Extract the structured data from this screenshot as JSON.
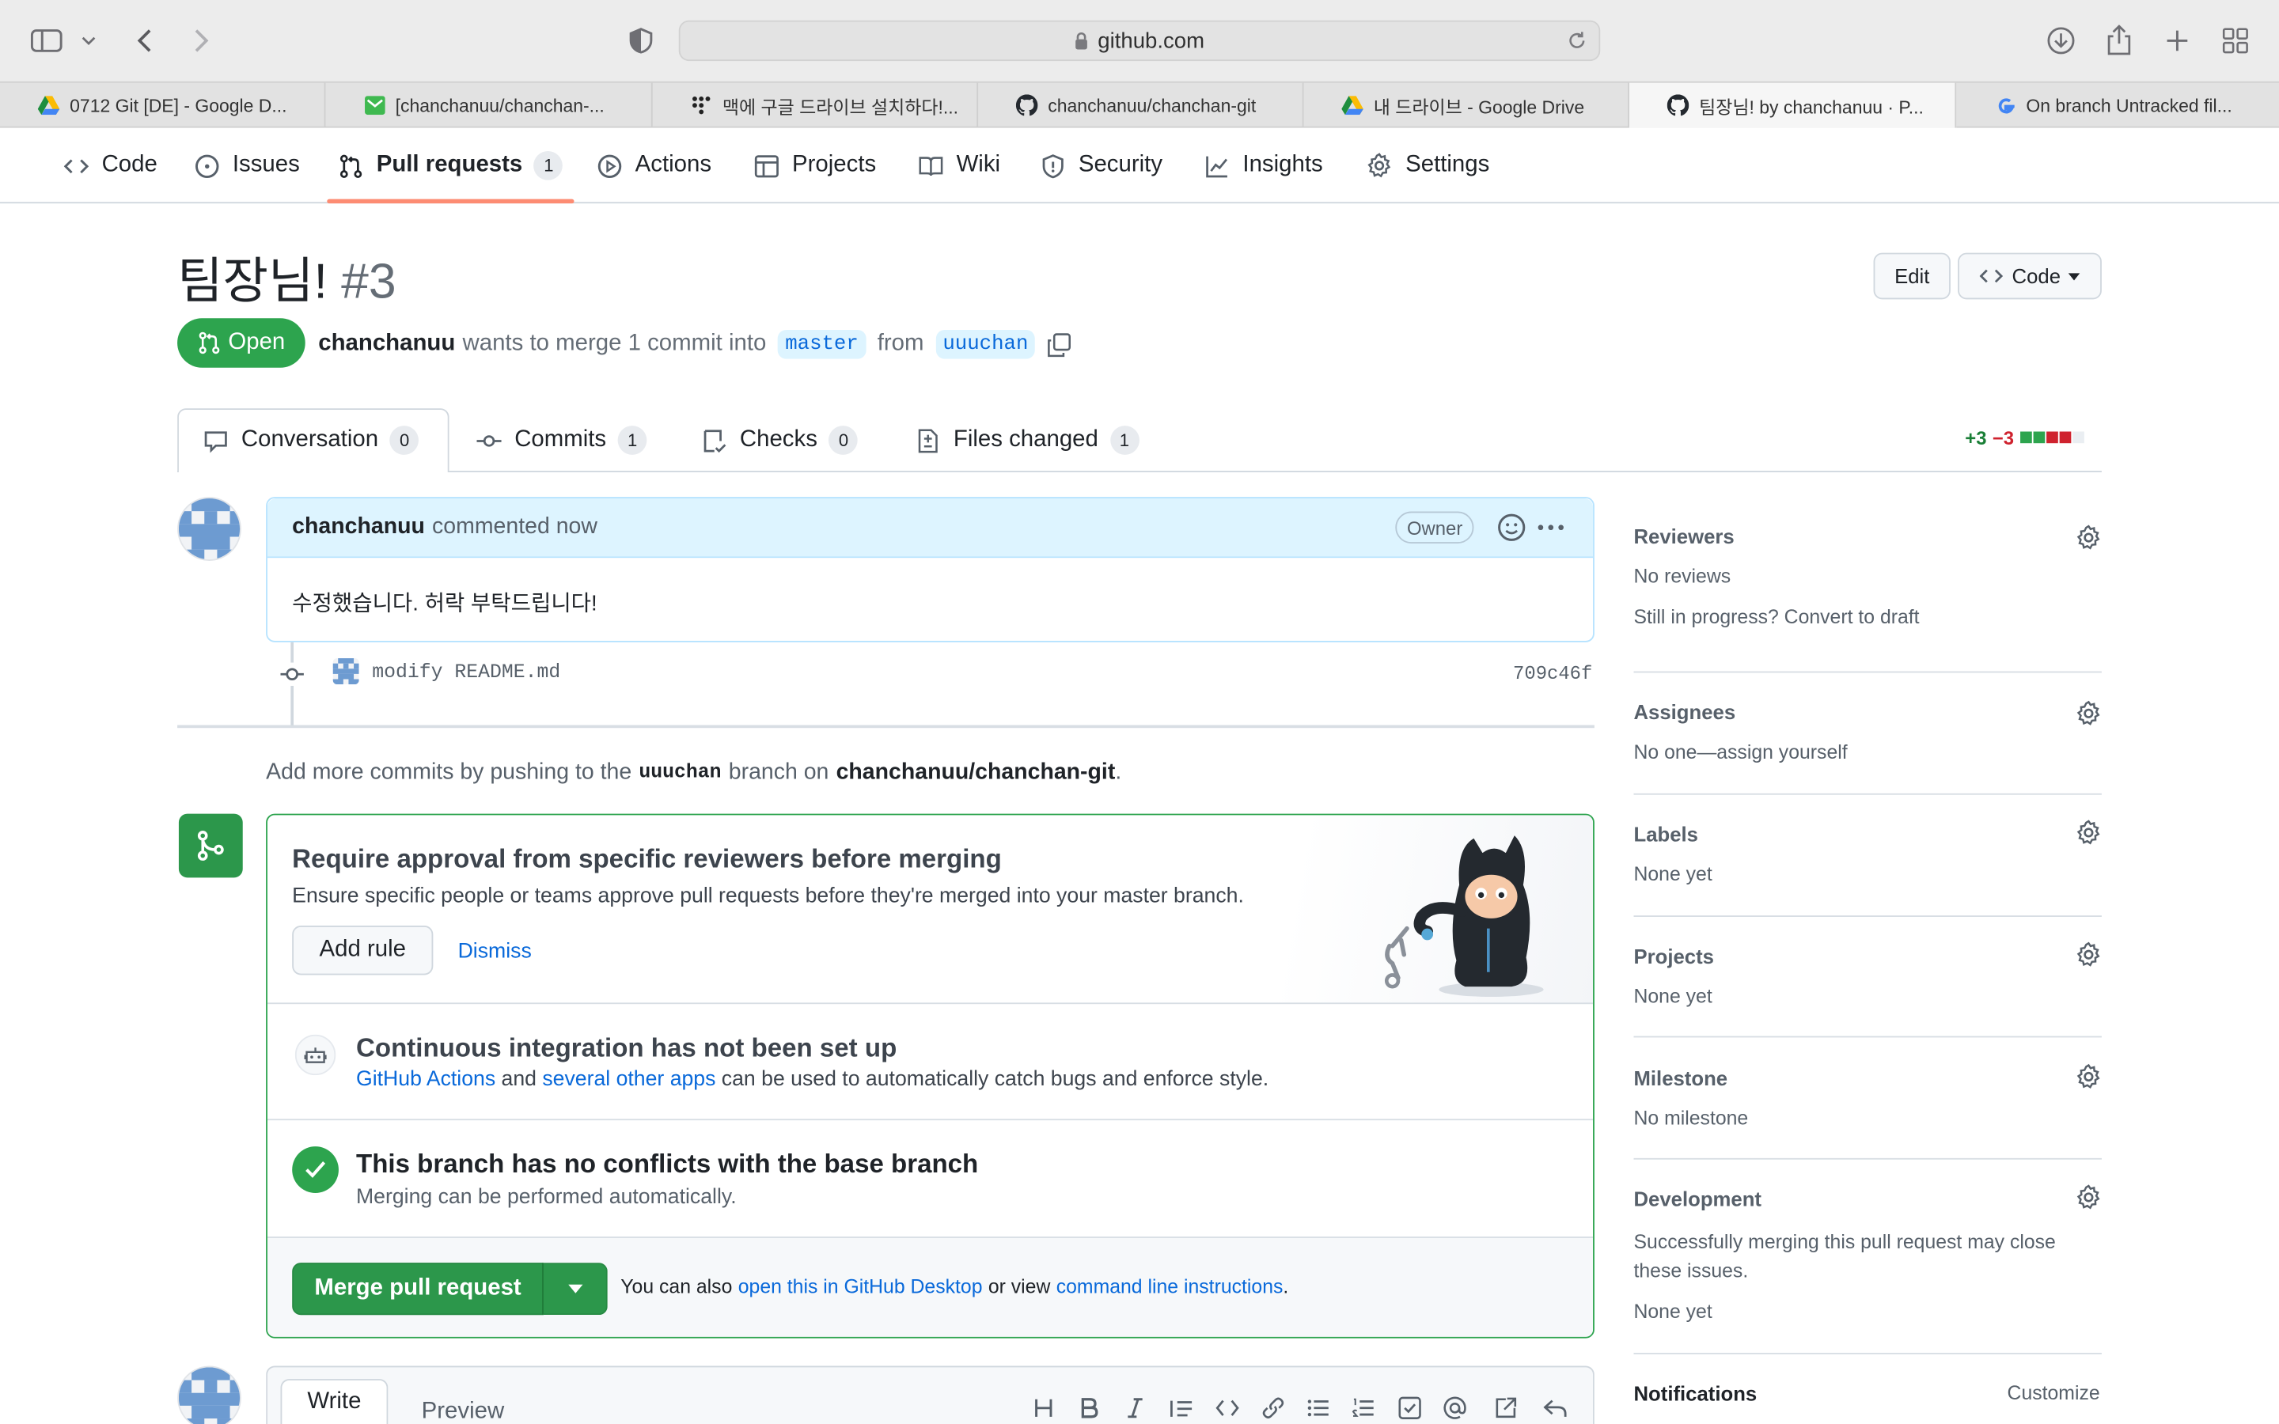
{
  "browser": {
    "url": "github.com",
    "tabs": [
      {
        "label": "0712 Git [DE] - Google D..."
      },
      {
        "label": "[chanchanuu/chanchan-..."
      },
      {
        "label": "맥에 구글 드라이브 설치하다!..."
      },
      {
        "label": "chanchanuu/chanchan-git"
      },
      {
        "label": "내 드라이브 - Google Drive"
      },
      {
        "label": "팀장님! by chanchanuu · P..."
      },
      {
        "label": "On branch Untracked fil..."
      }
    ]
  },
  "repo_nav": {
    "items": [
      {
        "label": "Code",
        "icon": "code-icon"
      },
      {
        "label": "Issues",
        "icon": "issue-icon"
      },
      {
        "label": "Pull requests",
        "icon": "pull-request-icon",
        "count": "1"
      },
      {
        "label": "Actions",
        "icon": "play-icon"
      },
      {
        "label": "Projects",
        "icon": "table-icon"
      },
      {
        "label": "Wiki",
        "icon": "book-icon"
      },
      {
        "label": "Security",
        "icon": "shield-icon"
      },
      {
        "label": "Insights",
        "icon": "graph-icon"
      },
      {
        "label": "Settings",
        "icon": "gear-icon"
      }
    ]
  },
  "pr": {
    "title": "팀장님!",
    "number": "#3",
    "state": "Open",
    "author": "chanchanuu",
    "merge_text": "wants to merge 1 commit into",
    "base": "master",
    "from_text": "from",
    "head": "uuuchan",
    "edit_label": "Edit",
    "code_label": "Code"
  },
  "pr_tabs": [
    {
      "label": "Conversation",
      "count": "0"
    },
    {
      "label": "Commits",
      "count": "1"
    },
    {
      "label": "Checks",
      "count": "0"
    },
    {
      "label": "Files changed",
      "count": "1"
    }
  ],
  "diffstat": {
    "added": "+3",
    "removed": "−3"
  },
  "comment": {
    "author": "chanchanuu",
    "meta": "commented now",
    "badge": "Owner",
    "body": "수정했습니다. 허락 부탁드립니다!"
  },
  "commit": {
    "message": "modify README.md",
    "sha": "709c46f"
  },
  "push_note": {
    "pre": "Add more commits by pushing to the",
    "branch": "uuuchan",
    "mid": "branch on",
    "repo": "chanchanuu/chanchan-git",
    "end": "."
  },
  "merge_box": {
    "rule_title": "Require approval from specific reviewers before merging",
    "rule_desc": "Ensure specific people or teams approve pull requests before they're merged into your master branch.",
    "add_rule": "Add rule",
    "dismiss": "Dismiss",
    "ci_title": "Continuous integration has not been set up",
    "ci_link1": "GitHub Actions",
    "ci_and": "and",
    "ci_link2": "several other apps",
    "ci_rest": "can be used to automatically catch bugs and enforce style.",
    "conflict_title": "This branch has no conflicts with the base branch",
    "conflict_desc": "Merging can be performed automatically.",
    "merge_button": "Merge pull request",
    "also_pre": "You can also",
    "also_link1": "open this in GitHub Desktop",
    "also_mid": "or view",
    "also_link2": "command line instructions",
    "also_end": "."
  },
  "editor": {
    "write": "Write",
    "preview": "Preview"
  },
  "sidebar": {
    "reviewers": {
      "title": "Reviewers",
      "value": "No reviews",
      "extra": "Still in progress? Convert to draft"
    },
    "assignees": {
      "title": "Assignees",
      "value": "No one—assign yourself"
    },
    "labels": {
      "title": "Labels",
      "value": "None yet"
    },
    "projects": {
      "title": "Projects",
      "value": "None yet"
    },
    "milestone": {
      "title": "Milestone",
      "value": "No milestone"
    },
    "development": {
      "title": "Development",
      "desc": "Successfully merging this pull request may close these issues.",
      "value": "None yet"
    },
    "notifications": {
      "title": "Notifications",
      "action": "Customize"
    }
  },
  "colors": {
    "accent": "#0969da",
    "open_green": "#2da44e",
    "merge_green": "#2c974b",
    "danger": "#cf222e"
  }
}
